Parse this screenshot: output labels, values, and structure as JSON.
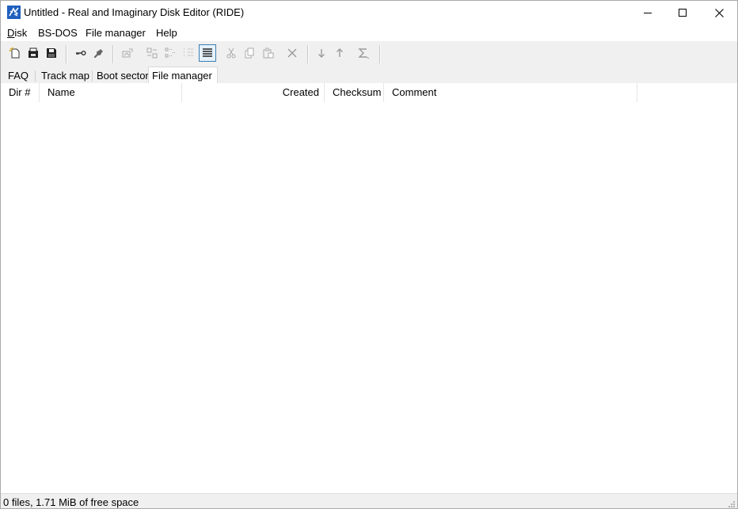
{
  "window": {
    "title": "Untitled - Real and Imaginary Disk Editor (RIDE)",
    "app_icon": "ride-app-icon",
    "controls": [
      "minimize-icon",
      "maximize-icon",
      "close-icon"
    ]
  },
  "menubar": {
    "items": [
      {
        "label": "Disk",
        "mnemonic": "D"
      },
      {
        "label": "BS-DOS"
      },
      {
        "label": "File manager"
      },
      {
        "label": "Help"
      }
    ]
  },
  "toolbar": {
    "buttons": [
      {
        "icon": "new-file-icon",
        "enabled": true
      },
      {
        "icon": "open-icon",
        "enabled": true
      },
      {
        "icon": "save-icon",
        "enabled": true
      },
      {
        "icon": "key-icon",
        "enabled": true
      },
      {
        "icon": "wrench-icon",
        "enabled": true
      },
      {
        "icon": "image-tools-icon",
        "enabled": false
      },
      {
        "icon": "large-icons-view-icon",
        "enabled": false
      },
      {
        "icon": "small-icons-view-icon",
        "enabled": false
      },
      {
        "icon": "list-view-icon",
        "enabled": false
      },
      {
        "icon": "details-view-icon",
        "enabled": true,
        "active": true
      },
      {
        "icon": "cut-icon",
        "enabled": false
      },
      {
        "icon": "copy-icon",
        "enabled": false
      },
      {
        "icon": "paste-icon",
        "enabled": false
      },
      {
        "icon": "delete-icon",
        "enabled": false
      },
      {
        "icon": "move-down-icon",
        "enabled": false
      },
      {
        "icon": "move-up-icon",
        "enabled": false
      },
      {
        "icon": "sum-icon",
        "enabled": false
      }
    ]
  },
  "tabs": [
    {
      "label": "FAQ",
      "selected": false
    },
    {
      "label": "Track map",
      "selected": false
    },
    {
      "label": "Boot sector",
      "selected": false
    },
    {
      "label": "File manager",
      "selected": true
    }
  ],
  "file_list": {
    "columns": [
      "Dir #",
      "Name",
      "Created",
      "Checksum",
      "Comment"
    ],
    "rows": []
  },
  "statusbar": {
    "text": "0 files, 1.71 MiB of free space"
  },
  "colors": {
    "chrome": "#f0f0f0",
    "active_button_border": "#3c7fb1",
    "active_button_fill": "#e5f1fb",
    "app_icon_blue": "#1f5fbf"
  }
}
